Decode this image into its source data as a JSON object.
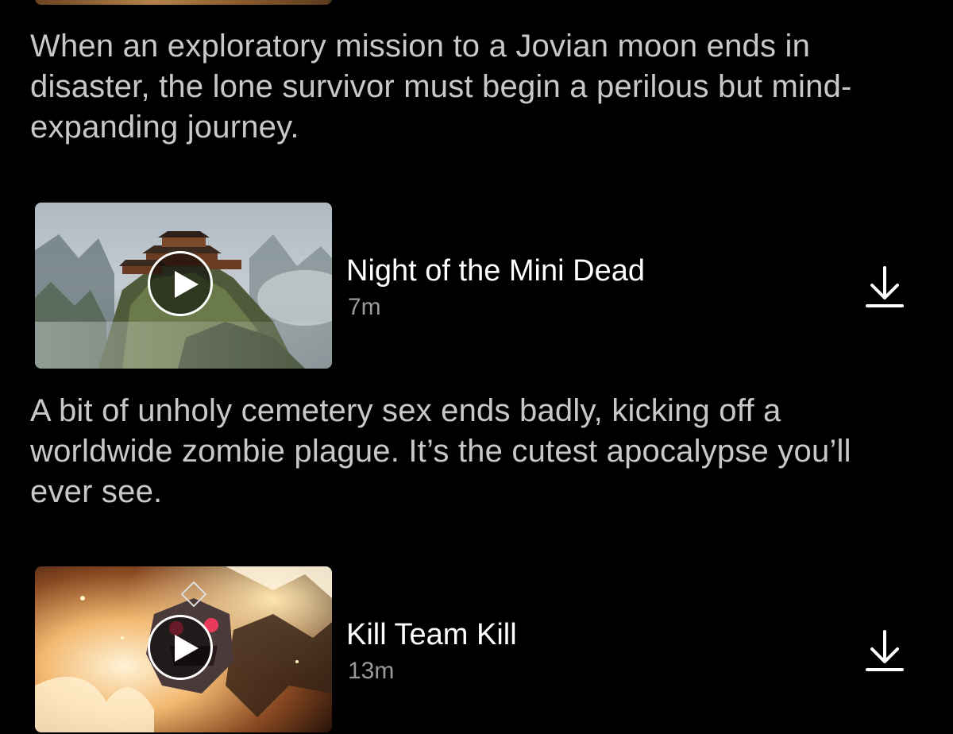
{
  "previous_episode": {
    "synopsis": "When an exploratory mission to a Jovian moon ends in disaster, the lone survivor must begin a perilous but mind-expanding journey."
  },
  "episodes": [
    {
      "title": "Night of the Mini Dead",
      "duration": "7m",
      "synopsis": "A bit of unholy cemetery sex ends badly, kicking off a worldwide zombie plague. It’s the cutest apocalypse you’ll ever see.",
      "play_icon": "play-icon",
      "download_icon": "download-icon"
    },
    {
      "title": "Kill Team Kill",
      "duration": "13m",
      "play_icon": "play-icon",
      "download_icon": "download-icon"
    }
  ],
  "colors": {
    "background": "#000000",
    "title": "#ffffff",
    "synopsis": "#c8c8c8",
    "duration": "#9a9a9a"
  }
}
